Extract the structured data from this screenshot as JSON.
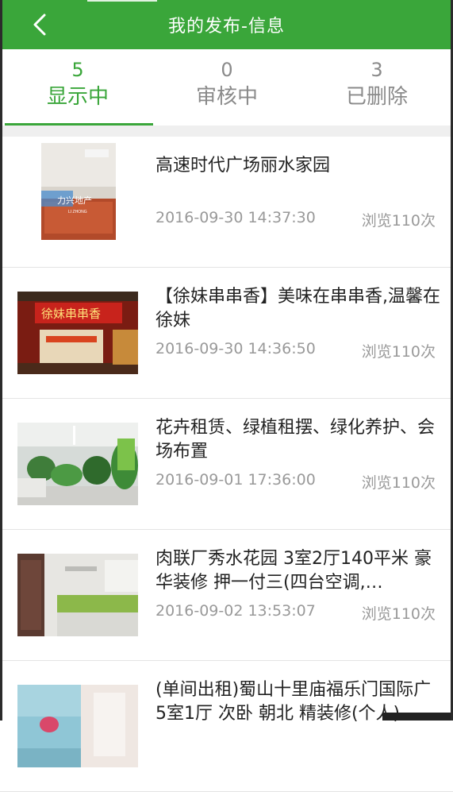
{
  "header": {
    "title": "我的发布-信息",
    "back_icon": "chevron-left-icon",
    "background_color": "#3aa63a"
  },
  "tabs": [
    {
      "count": "5",
      "label": "显示中",
      "active": true
    },
    {
      "count": "0",
      "label": "审核中",
      "active": false
    },
    {
      "count": "3",
      "label": "已删除",
      "active": false
    }
  ],
  "posts": [
    {
      "title": "高速时代广场丽水家园",
      "date": "2016-09-30 14:37:30",
      "views": "浏览110次",
      "watermark": "力兴地产",
      "watermark_sub": "LI ZHONG"
    },
    {
      "title": "【徐妹串串香】美味在串串香,温馨在徐妹",
      "date": "2016-09-30 14:36:50",
      "views": "浏览110次",
      "sign_text": "徐妹串串香"
    },
    {
      "title": "花卉租赁、绿植租摆、绿化养护、会场布置",
      "date": "2016-09-01 17:36:00",
      "views": "浏览110次"
    },
    {
      "title": "肉联厂秀水花园 3室2厅140平米 豪华装修 押一付三(四台空调,…",
      "date": "2016-09-02 13:53:07",
      "views": "浏览110次"
    },
    {
      "title": "(单间出租)蜀山十里庙福乐门国际广 5室1厅 次卧 朝北 精装修(个人)",
      "date": "",
      "views": ""
    }
  ]
}
